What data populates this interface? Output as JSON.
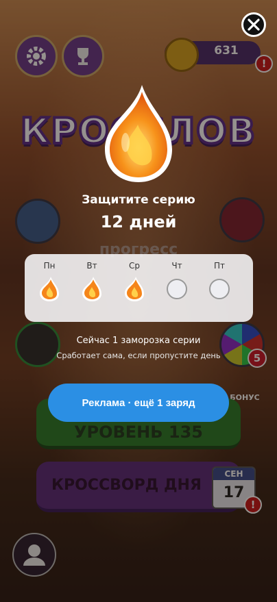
{
  "background": {
    "logo_text": "КРОССЛОВ",
    "coins": "631",
    "alert_mark": "!",
    "progress_word": "прогресс",
    "wheel_badge": "5",
    "bonus_label": "БОНУС",
    "level_button": "УРОВЕНЬ 135",
    "daily_button": "КРОССВОРД ДНЯ",
    "calendar_month": "СЕН",
    "calendar_day": "17"
  },
  "streak": {
    "title": "Защитите серию",
    "count": "12 дней",
    "days": [
      {
        "label": "Пн",
        "done": true
      },
      {
        "label": "Вт",
        "done": true
      },
      {
        "label": "Ср",
        "done": true
      },
      {
        "label": "Чт",
        "done": false
      },
      {
        "label": "Пт",
        "done": false
      }
    ],
    "freeze_text": "Сейчас 1 заморозка серии",
    "freeze_subtext": "Сработает сама, если пропустите день",
    "ad_button": "Реклама · ещё 1 заряд"
  },
  "colors": {
    "ad_button": "#2b8fe4",
    "flame_outer": "#f58a14",
    "flame_inner": "#ffd04a"
  }
}
